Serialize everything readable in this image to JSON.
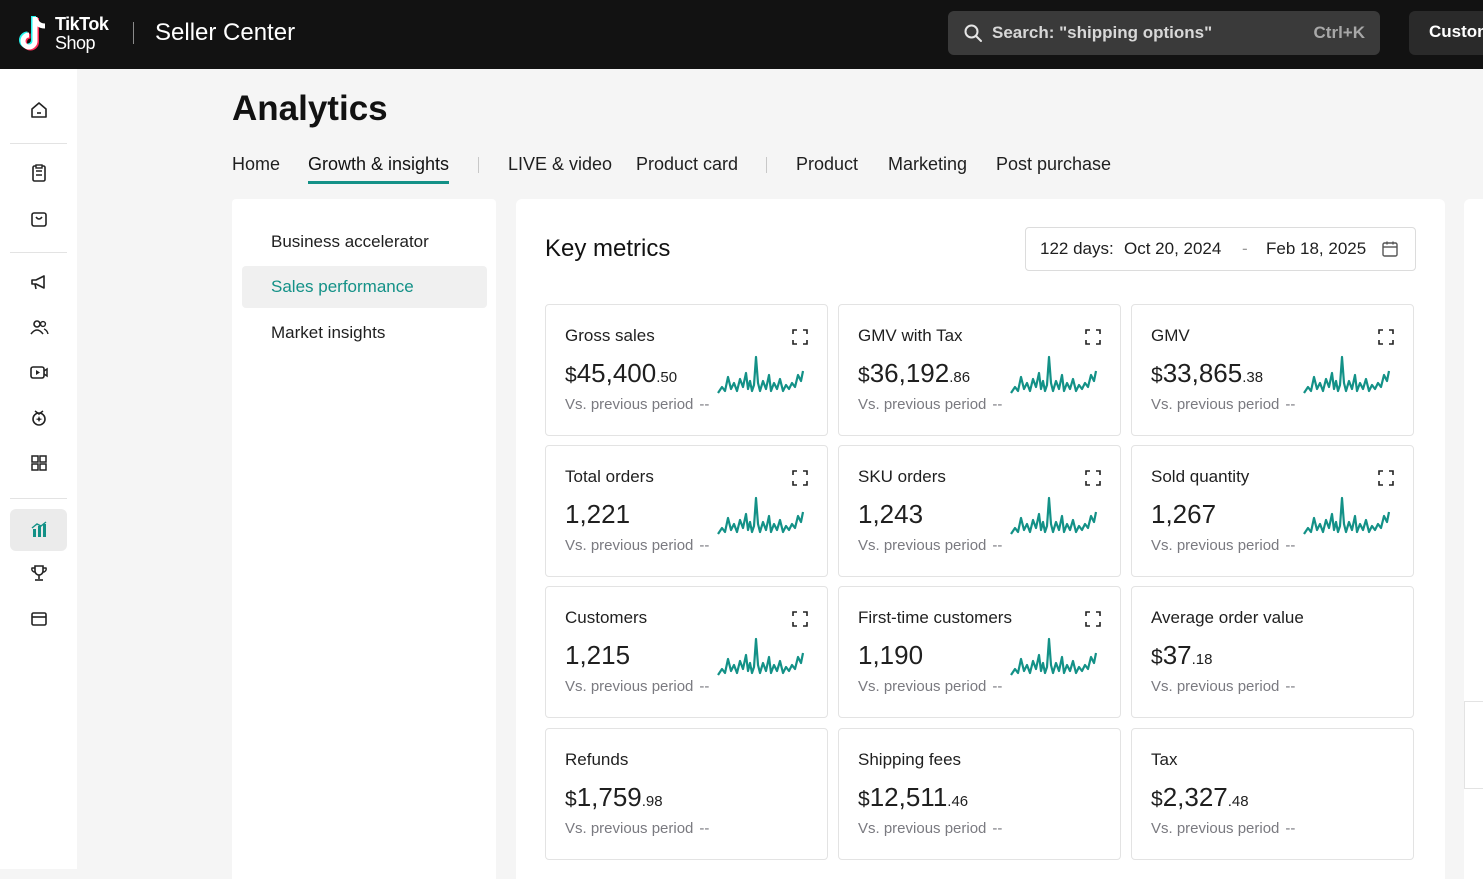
{
  "topbar": {
    "logo_line1": "TikTok",
    "logo_line2": "Shop",
    "app_title": "Seller Center",
    "search_placeholder": "Search: \"shipping options\"",
    "search_shortcut": "Ctrl+K",
    "right_button": "Custom"
  },
  "leftnav": {
    "items": [
      {
        "icon": "home-icon"
      },
      {
        "icon": "orders-icon"
      },
      {
        "icon": "products-icon"
      },
      {
        "icon": "marketing-icon"
      },
      {
        "icon": "affiliates-icon"
      },
      {
        "icon": "video-icon"
      },
      {
        "icon": "growth-icon"
      },
      {
        "icon": "apps-icon"
      },
      {
        "icon": "analytics-icon",
        "active": true
      },
      {
        "icon": "rewards-icon"
      },
      {
        "icon": "finance-icon"
      }
    ]
  },
  "page": {
    "title": "Analytics",
    "tabs": [
      "Home",
      "Growth & insights",
      "LIVE & video",
      "Product card",
      "Product",
      "Marketing",
      "Post purchase"
    ],
    "active_tab": "Growth & insights"
  },
  "subnav": {
    "items": [
      "Business accelerator",
      "Sales performance",
      "Market insights"
    ],
    "active": "Sales performance"
  },
  "key_metrics": {
    "title": "Key metrics",
    "date_prefix": "122 days:",
    "date_start": "Oct 20, 2024",
    "date_sep": "-",
    "date_end": "Feb 18, 2025",
    "compare_label": "Vs. previous period",
    "compare_value": "--",
    "cards": [
      {
        "title": "Gross sales",
        "currency": "$",
        "int": "45,400",
        "dec": ".50",
        "expand": true,
        "spark": true
      },
      {
        "title": "GMV with Tax",
        "currency": "$",
        "int": "36,192",
        "dec": ".86",
        "expand": true,
        "spark": true
      },
      {
        "title": "GMV",
        "currency": "$",
        "int": "33,865",
        "dec": ".38",
        "expand": true,
        "spark": true
      },
      {
        "title": "Total orders",
        "currency": "",
        "int": "1,221",
        "dec": "",
        "expand": true,
        "spark": true
      },
      {
        "title": "SKU orders",
        "currency": "",
        "int": "1,243",
        "dec": "",
        "expand": true,
        "spark": true
      },
      {
        "title": "Sold quantity",
        "currency": "",
        "int": "1,267",
        "dec": "",
        "expand": true,
        "spark": true
      },
      {
        "title": "Customers",
        "currency": "",
        "int": "1,215",
        "dec": "",
        "expand": true,
        "spark": true
      },
      {
        "title": "First-time customers",
        "currency": "",
        "int": "1,190",
        "dec": "",
        "expand": true,
        "spark": true
      },
      {
        "title": "Average order value",
        "currency": "$",
        "int": "37",
        "dec": ".18",
        "expand": false,
        "spark": false
      },
      {
        "title": "Refunds",
        "currency": "$",
        "int": "1,759",
        "dec": ".98",
        "expand": false,
        "spark": false
      },
      {
        "title": "Shipping fees",
        "currency": "$",
        "int": "12,511",
        "dec": ".46",
        "expand": false,
        "spark": false
      },
      {
        "title": "Tax",
        "currency": "$",
        "int": "2,327",
        "dec": ".48",
        "expand": false,
        "spark": false
      }
    ]
  },
  "colors": {
    "accent": "#139187",
    "topbar": "#121212"
  }
}
